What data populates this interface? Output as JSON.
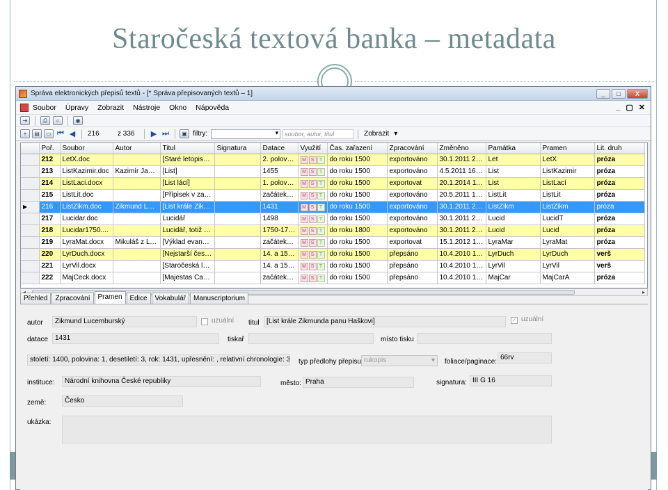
{
  "slide": {
    "title": "Staročeská textová banka – metadata"
  },
  "window": {
    "title": "Správa elektronických přepisů textů - [* Správa přepisovaných textů – 1]",
    "buttons": [
      "_",
      "□",
      "X"
    ]
  },
  "menu": {
    "items": [
      "Soubor",
      "Úpravy",
      "Zobrazit",
      "Nástroje",
      "Okno",
      "Nápověda"
    ],
    "mdi": [
      "_",
      "▢",
      "✕"
    ]
  },
  "nav": {
    "record": "216",
    "total": "z 336",
    "filter_label": "filtry:",
    "search_placeholder": "soubor, autor, titul",
    "show_label": "Zobrazit"
  },
  "grid": {
    "columns": [
      "Poř.",
      "Soubor",
      "Autor",
      "Titul",
      "Signatura",
      "Datace",
      "Využití",
      "Čas. zařazení",
      "Zpracování",
      "Změněno",
      "Památka",
      "Pramen",
      "Lit. druh"
    ],
    "rows": [
      {
        "style": "yellow",
        "cells": [
          "212",
          "LetX.doc",
          "",
          "[Staré letopisy ...",
          "",
          "2. polovin...",
          "",
          "do roku 1500",
          "exportováno",
          "30.1.2011 20...",
          "Let",
          "LetX",
          "próza"
        ]
      },
      {
        "style": "white",
        "cells": [
          "213",
          "ListKazimir.doc",
          "Kazimír Jage...",
          "[List]",
          "",
          "1455",
          "",
          "do roku 1500",
          "exportováno",
          "4.5.2011 16:03",
          "List",
          "ListKazimir",
          "próza"
        ]
      },
      {
        "style": "yellow",
        "cells": [
          "214",
          "ListLaci.docx",
          "",
          "[List lácí]",
          "",
          "1. polovin...",
          "",
          "do roku 1500",
          "exportovat",
          "20.1.2014 11...",
          "List",
          "ListLací",
          "próza"
        ]
      },
      {
        "style": "white",
        "cells": [
          "215",
          "ListLit.doc",
          "",
          "[Přípisek v zakl...",
          "",
          "začátek 1...",
          "",
          "do roku 1500",
          "exportováno",
          "20.5.2011 18...",
          "ListLit",
          "ListLit",
          "próza"
        ]
      },
      {
        "style": "sel",
        "cells": [
          "216",
          "ListZikm.doc",
          "Zikmund Luc...",
          "[List krále Zikm...",
          "",
          "1431",
          "",
          "do roku 1500",
          "exportováno",
          "30.1.2011 20...",
          "ListZikm",
          "ListZikm",
          "próza"
        ]
      },
      {
        "style": "white",
        "cells": [
          "217",
          "Lucidar.doc",
          "",
          "Lucidář",
          "",
          "1498",
          "",
          "do roku 1500",
          "exportováno",
          "30.1.2011 20...",
          "Lucid",
          "LucidT",
          "próza"
        ]
      },
      {
        "style": "yellow",
        "cells": [
          "218",
          "Lucidar1750....",
          "",
          "Lucidář, totiž k...",
          "",
          "1750-1775",
          "",
          "do roku 1800",
          "exportováno",
          "30.1.2011 20...",
          "Lucid",
          "Lucid",
          "próza"
        ]
      },
      {
        "style": "white",
        "cells": [
          "219",
          "LyraMat.docx",
          "Mikuláš z Lyry",
          "[Výklad evange...",
          "",
          "začátek 1...",
          "",
          "do roku 1500",
          "exportovat",
          "15.1.2012 14...",
          "LyraMar",
          "LyraMat",
          "próza"
        ]
      },
      {
        "style": "yellow",
        "cells": [
          "220",
          "LyrDuch.docx",
          "",
          "[Nejstarší česk...",
          "",
          "14. a 15. ...",
          "",
          "do roku 1500",
          "přepsáno",
          "10.4.2010 15...",
          "LyrDuch",
          "LyrDuch",
          "verš"
        ]
      },
      {
        "style": "white",
        "cells": [
          "221",
          "LyrVil.docx",
          "",
          "[Staročeská lyri...",
          "",
          "14. a 15. ...",
          "",
          "do roku 1500",
          "přepsáno",
          "10.4.2010 16...",
          "LyrVil",
          "LyrVil",
          "verš"
        ]
      },
      {
        "style": "white",
        "cells": [
          "222",
          "MajCeck.docx",
          "",
          "[Majestas Caro...",
          "",
          "začátek 1...",
          "",
          "do roku 1500",
          "přepsáno",
          "10.4.2010 16...",
          "MajCar",
          "MajCarA",
          "próza"
        ]
      }
    ],
    "mst_letters": [
      "M",
      "S",
      "T"
    ]
  },
  "tabs": [
    "Přehled",
    "Zpracování",
    "Pramen",
    "Edice",
    "Vokabulář",
    "Manuscriptorium"
  ],
  "form": {
    "autor_label": "autor",
    "autor_value": "Zikmund Lucemburský",
    "uzualni_label": "uzuální",
    "titul_label": "titul",
    "titul_value": "[List krále Zikmunda panu Haškovi]",
    "uzualni2_label": "uzuální",
    "datace_label": "datace",
    "datace_value": "1431",
    "tiskar_label": "tiskař",
    "misto_label": "místo tisku",
    "chronology_value": "století: 1400, polovina: 1, desetiletí: 3, rok: 1431, upřesnění: , relativní chronologie: 3",
    "typ_label": "typ předlohy přepisu",
    "typ_value": "rukopis",
    "foliace_label": "foliace/paginace:",
    "foliace_value": "66rv",
    "instituce_label": "instituce:",
    "instituce_value": "Národní knihovna České republiky",
    "mesto_label": "město:",
    "mesto_value": "Praha",
    "signatura_label": "signatura:",
    "signatura_value": "III G 16",
    "zeme_label": "země:",
    "zeme_value": "Česko",
    "ukazka_label": "ukázka:"
  }
}
